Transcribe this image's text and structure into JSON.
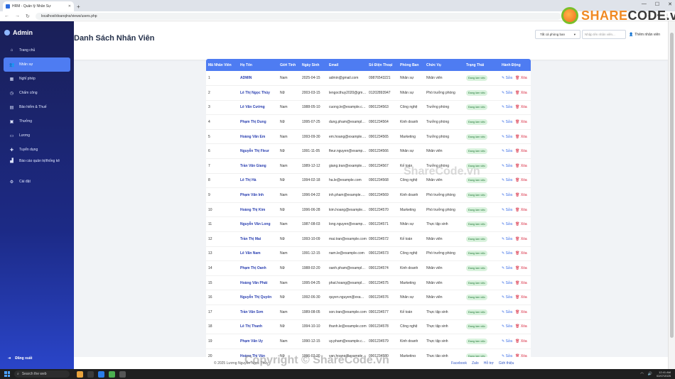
{
  "browser": {
    "tab_title": "HRM - Quản lý Nhân Sự",
    "url": "localhost/doanqlns/views/users.php"
  },
  "sidebar": {
    "brand": "Admin",
    "items": [
      {
        "label": "Trang chủ",
        "icon": "home-icon"
      },
      {
        "label": "Nhân sự",
        "icon": "users-icon",
        "active": true
      },
      {
        "label": "Nghỉ phép",
        "icon": "calendar-icon"
      },
      {
        "label": "Chấm công",
        "icon": "clock-icon"
      },
      {
        "label": "Bảo hiểm & Thuế",
        "icon": "file-icon"
      },
      {
        "label": "Thưởng",
        "icon": "gift-icon"
      },
      {
        "label": "Lương",
        "icon": "money-icon"
      },
      {
        "label": "Tuyển dụng",
        "icon": "user-plus-icon"
      },
      {
        "label": "Báo cáo quản trị/thống kê",
        "icon": "chart-icon"
      },
      {
        "label": "Cài đặt",
        "icon": "gear-icon"
      }
    ],
    "logout": "Đăng xuất"
  },
  "header": {
    "title": "Danh Sách Nhân Viên",
    "filter_value": "Tất cả phòng ban",
    "search_placeholder": "Nhập tên nhân viên...",
    "add_label": "Thêm nhân viên"
  },
  "table": {
    "columns": [
      "Mã Nhân Viên",
      "Họ Tên",
      "Giới Tính",
      "Ngày Sinh",
      "Email",
      "Số Điện Thoại",
      "Phòng Ban",
      "Chức Vụ",
      "Trạng Thái",
      "Hành Động"
    ],
    "edit_label": "Sửa",
    "delete_label": "Xóa",
    "rows": [
      [
        "1",
        "ADMIN",
        "Nam",
        "2025-04-15",
        "admin@gmail.com",
        "09876543221",
        "Nhân sự",
        "Nhân viên",
        "Đang làm việc"
      ],
      [
        "2",
        "Lê Thị Ngọc Thủy",
        "Nữ",
        "2003-03-15",
        "lengocthuy2020@gmail.com",
        "01202893947",
        "Nhân sự",
        "Phó trưởng phòng",
        "Đang làm việc"
      ],
      [
        "3",
        "Lê Văn Cường",
        "Nam",
        "1988-05-10",
        "cuong.le@example.com",
        "0901234563",
        "Công nghệ",
        "Trưởng phòng",
        "Đang làm việc"
      ],
      [
        "4",
        "Phạm Thị Dung",
        "Nữ",
        "1995-07-25",
        "dung.pham@example.com",
        "0901234564",
        "Kinh doanh",
        "Trưởng phòng",
        "Đang làm việc"
      ],
      [
        "5",
        "Hoàng Văn Em",
        "Nam",
        "1993-09-30",
        "em.hoang@example.com",
        "0901234565",
        "Marketing",
        "Trưởng phòng",
        "Đang làm việc"
      ],
      [
        "6",
        "Nguyễn Thị Fleur",
        "Nữ",
        "1991-11-05",
        "fleur.nguyen@example.com",
        "0901234566",
        "Nhân sự",
        "Nhân viên",
        "Đang làm việc"
      ],
      [
        "7",
        "Trần Văn Giang",
        "Nam",
        "1989-12-12",
        "giang.tran@example.com",
        "0901234567",
        "Kế toán",
        "Trưởng phòng",
        "Đang làm việc"
      ],
      [
        "8",
        "Lê Thị Hà",
        "Nữ",
        "1994-02-18",
        "ha.le@example.com",
        "0901234568",
        "Công nghệ",
        "Nhân viên",
        "Đang làm việc"
      ],
      [
        "9",
        "Phạm Văn Inh",
        "Nam",
        "1996-04-22",
        "inh.pham@example.com",
        "0901234569",
        "Kinh doanh",
        "Phó trưởng phòng",
        "Đang làm việc"
      ],
      [
        "10",
        "Hoàng Thị Kim",
        "Nữ",
        "1996-06-28",
        "kim.hoang@example.com",
        "0901234570",
        "Marketing",
        "Phó trưởng phòng",
        "Đang làm việc"
      ],
      [
        "11",
        "Nguyễn Văn Long",
        "Nam",
        "1987-08-03",
        "long.nguyen@example.com",
        "0901234571",
        "Nhân sự",
        "Thực tập sinh",
        "Đang làm việc"
      ],
      [
        "12",
        "Trần Thị Mai",
        "Nữ",
        "1993-10-09",
        "mai.tran@example.com",
        "0901234572",
        "Kế toán",
        "Nhân viên",
        "Đang làm việc"
      ],
      [
        "13",
        "Lê Văn Nam",
        "Nam",
        "1991-12-15",
        "nam.le@example.com",
        "0901234573",
        "Công nghệ",
        "Phó trưởng phòng",
        "Đang làm việc"
      ],
      [
        "14",
        "Phạm Thị Oanh",
        "Nữ",
        "1988-02-20",
        "oanh.pham@example.com",
        "0901234574",
        "Kinh doanh",
        "Nhân viên",
        "Đang làm việc"
      ],
      [
        "15",
        "Hoàng Văn Phát",
        "Nam",
        "1995-04-25",
        "phat.hoang@example.com",
        "0901234575",
        "Marketing",
        "Nhân viên",
        "Đang làm việc"
      ],
      [
        "16",
        "Nguyễn Thị Quyên",
        "Nữ",
        "1992-06-30",
        "quyen.nguyen@example.com",
        "0901234576",
        "Nhân sự",
        "Nhân viên",
        "Đang làm việc"
      ],
      [
        "17",
        "Trần Văn Sơn",
        "Nam",
        "1989-08-05",
        "son.tran@example.com",
        "0901234577",
        "Kế toán",
        "Thực tập sinh",
        "Đang làm việc"
      ],
      [
        "18",
        "Lê Thị Thanh",
        "Nữ",
        "1994-10-10",
        "thanh.le@example.com",
        "0901234578",
        "Công nghệ",
        "Thực tập sinh",
        "Đang làm việc"
      ],
      [
        "19",
        "Phạm Văn Uy",
        "Nam",
        "1990-12-15",
        "uy.pham@example.com",
        "0901234579",
        "Kinh doanh",
        "Thực tập sinh",
        "Đang làm việc"
      ],
      [
        "20",
        "Hoàng Thị Vân",
        "Nữ",
        "1996-02-20",
        "van.hoang@example.com",
        "0901234580",
        "Marketing",
        "Thực tập sinh",
        "Đang làm việc"
      ]
    ]
  },
  "footer": {
    "copyright": "© 2025 Lương Nguyễn Ngọc Thủy",
    "links": [
      "Facebook",
      "Zalo",
      "Hỗ trợ",
      "Giới thiệu"
    ]
  },
  "taskbar": {
    "search_placeholder": "Search the web",
    "time": "12:41 AM",
    "date": "02/07/2025"
  },
  "watermark": {
    "logo_text_a": "SHARE",
    "logo_text_b": "CODE.vn",
    "center": "ShareCode.vn",
    "bottom": "Copyright © ShareCode.vn"
  },
  "colors": {
    "sidebar_top": "#1a1f57",
    "sidebar_bottom": "#2a45c9",
    "accent": "#4e7cf2",
    "name_text": "#2a3fb0",
    "status_bg": "#d9f2dd",
    "status_text": "#237a38",
    "delete": "#d7263d"
  }
}
